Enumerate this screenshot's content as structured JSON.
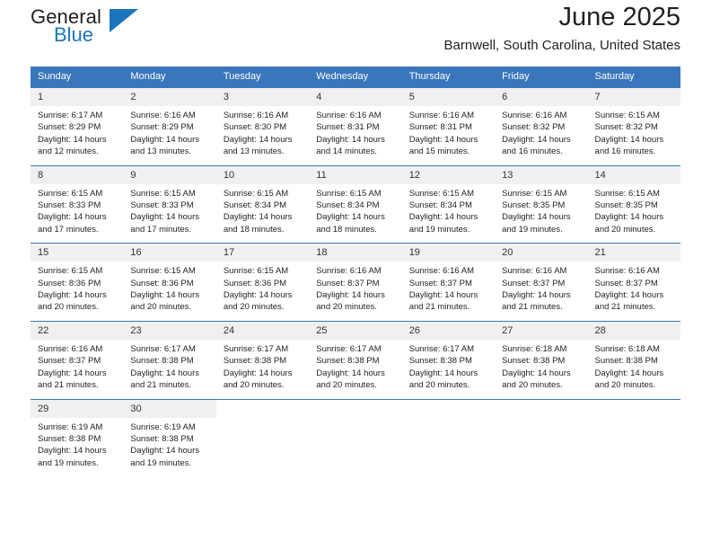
{
  "brand": {
    "name_top": "General",
    "name_bottom": "Blue",
    "triangle_icon": "brand-triangle-icon",
    "colors": {
      "black": "#231f20",
      "blue": "#1b75bb"
    }
  },
  "header": {
    "title": "June 2025",
    "location": "Barnwell, South Carolina, United States"
  },
  "calendar": {
    "header_background": "#3a76bb",
    "daynum_background": "#f0f0f0",
    "weekdays": [
      "Sunday",
      "Monday",
      "Tuesday",
      "Wednesday",
      "Thursday",
      "Friday",
      "Saturday"
    ],
    "weeks": [
      [
        {
          "day": "1",
          "sunrise": "Sunrise: 6:17 AM",
          "sunset": "Sunset: 8:29 PM",
          "daylight_1": "Daylight: 14 hours",
          "daylight_2": "and 12 minutes."
        },
        {
          "day": "2",
          "sunrise": "Sunrise: 6:16 AM",
          "sunset": "Sunset: 8:29 PM",
          "daylight_1": "Daylight: 14 hours",
          "daylight_2": "and 13 minutes."
        },
        {
          "day": "3",
          "sunrise": "Sunrise: 6:16 AM",
          "sunset": "Sunset: 8:30 PM",
          "daylight_1": "Daylight: 14 hours",
          "daylight_2": "and 13 minutes."
        },
        {
          "day": "4",
          "sunrise": "Sunrise: 6:16 AM",
          "sunset": "Sunset: 8:31 PM",
          "daylight_1": "Daylight: 14 hours",
          "daylight_2": "and 14 minutes."
        },
        {
          "day": "5",
          "sunrise": "Sunrise: 6:16 AM",
          "sunset": "Sunset: 8:31 PM",
          "daylight_1": "Daylight: 14 hours",
          "daylight_2": "and 15 minutes."
        },
        {
          "day": "6",
          "sunrise": "Sunrise: 6:16 AM",
          "sunset": "Sunset: 8:32 PM",
          "daylight_1": "Daylight: 14 hours",
          "daylight_2": "and 16 minutes."
        },
        {
          "day": "7",
          "sunrise": "Sunrise: 6:15 AM",
          "sunset": "Sunset: 8:32 PM",
          "daylight_1": "Daylight: 14 hours",
          "daylight_2": "and 16 minutes."
        }
      ],
      [
        {
          "day": "8",
          "sunrise": "Sunrise: 6:15 AM",
          "sunset": "Sunset: 8:33 PM",
          "daylight_1": "Daylight: 14 hours",
          "daylight_2": "and 17 minutes."
        },
        {
          "day": "9",
          "sunrise": "Sunrise: 6:15 AM",
          "sunset": "Sunset: 8:33 PM",
          "daylight_1": "Daylight: 14 hours",
          "daylight_2": "and 17 minutes."
        },
        {
          "day": "10",
          "sunrise": "Sunrise: 6:15 AM",
          "sunset": "Sunset: 8:34 PM",
          "daylight_1": "Daylight: 14 hours",
          "daylight_2": "and 18 minutes."
        },
        {
          "day": "11",
          "sunrise": "Sunrise: 6:15 AM",
          "sunset": "Sunset: 8:34 PM",
          "daylight_1": "Daylight: 14 hours",
          "daylight_2": "and 18 minutes."
        },
        {
          "day": "12",
          "sunrise": "Sunrise: 6:15 AM",
          "sunset": "Sunset: 8:34 PM",
          "daylight_1": "Daylight: 14 hours",
          "daylight_2": "and 19 minutes."
        },
        {
          "day": "13",
          "sunrise": "Sunrise: 6:15 AM",
          "sunset": "Sunset: 8:35 PM",
          "daylight_1": "Daylight: 14 hours",
          "daylight_2": "and 19 minutes."
        },
        {
          "day": "14",
          "sunrise": "Sunrise: 6:15 AM",
          "sunset": "Sunset: 8:35 PM",
          "daylight_1": "Daylight: 14 hours",
          "daylight_2": "and 20 minutes."
        }
      ],
      [
        {
          "day": "15",
          "sunrise": "Sunrise: 6:15 AM",
          "sunset": "Sunset: 8:36 PM",
          "daylight_1": "Daylight: 14 hours",
          "daylight_2": "and 20 minutes."
        },
        {
          "day": "16",
          "sunrise": "Sunrise: 6:15 AM",
          "sunset": "Sunset: 8:36 PM",
          "daylight_1": "Daylight: 14 hours",
          "daylight_2": "and 20 minutes."
        },
        {
          "day": "17",
          "sunrise": "Sunrise: 6:15 AM",
          "sunset": "Sunset: 8:36 PM",
          "daylight_1": "Daylight: 14 hours",
          "daylight_2": "and 20 minutes."
        },
        {
          "day": "18",
          "sunrise": "Sunrise: 6:16 AM",
          "sunset": "Sunset: 8:37 PM",
          "daylight_1": "Daylight: 14 hours",
          "daylight_2": "and 20 minutes."
        },
        {
          "day": "19",
          "sunrise": "Sunrise: 6:16 AM",
          "sunset": "Sunset: 8:37 PM",
          "daylight_1": "Daylight: 14 hours",
          "daylight_2": "and 21 minutes."
        },
        {
          "day": "20",
          "sunrise": "Sunrise: 6:16 AM",
          "sunset": "Sunset: 8:37 PM",
          "daylight_1": "Daylight: 14 hours",
          "daylight_2": "and 21 minutes."
        },
        {
          "day": "21",
          "sunrise": "Sunrise: 6:16 AM",
          "sunset": "Sunset: 8:37 PM",
          "daylight_1": "Daylight: 14 hours",
          "daylight_2": "and 21 minutes."
        }
      ],
      [
        {
          "day": "22",
          "sunrise": "Sunrise: 6:16 AM",
          "sunset": "Sunset: 8:37 PM",
          "daylight_1": "Daylight: 14 hours",
          "daylight_2": "and 21 minutes."
        },
        {
          "day": "23",
          "sunrise": "Sunrise: 6:17 AM",
          "sunset": "Sunset: 8:38 PM",
          "daylight_1": "Daylight: 14 hours",
          "daylight_2": "and 21 minutes."
        },
        {
          "day": "24",
          "sunrise": "Sunrise: 6:17 AM",
          "sunset": "Sunset: 8:38 PM",
          "daylight_1": "Daylight: 14 hours",
          "daylight_2": "and 20 minutes."
        },
        {
          "day": "25",
          "sunrise": "Sunrise: 6:17 AM",
          "sunset": "Sunset: 8:38 PM",
          "daylight_1": "Daylight: 14 hours",
          "daylight_2": "and 20 minutes."
        },
        {
          "day": "26",
          "sunrise": "Sunrise: 6:17 AM",
          "sunset": "Sunset: 8:38 PM",
          "daylight_1": "Daylight: 14 hours",
          "daylight_2": "and 20 minutes."
        },
        {
          "day": "27",
          "sunrise": "Sunrise: 6:18 AM",
          "sunset": "Sunset: 8:38 PM",
          "daylight_1": "Daylight: 14 hours",
          "daylight_2": "and 20 minutes."
        },
        {
          "day": "28",
          "sunrise": "Sunrise: 6:18 AM",
          "sunset": "Sunset: 8:38 PM",
          "daylight_1": "Daylight: 14 hours",
          "daylight_2": "and 20 minutes."
        }
      ],
      [
        {
          "day": "29",
          "sunrise": "Sunrise: 6:19 AM",
          "sunset": "Sunset: 8:38 PM",
          "daylight_1": "Daylight: 14 hours",
          "daylight_2": "and 19 minutes."
        },
        {
          "day": "30",
          "sunrise": "Sunrise: 6:19 AM",
          "sunset": "Sunset: 8:38 PM",
          "daylight_1": "Daylight: 14 hours",
          "daylight_2": "and 19 minutes."
        },
        {
          "day": "",
          "sunrise": "",
          "sunset": "",
          "daylight_1": "",
          "daylight_2": ""
        },
        {
          "day": "",
          "sunrise": "",
          "sunset": "",
          "daylight_1": "",
          "daylight_2": ""
        },
        {
          "day": "",
          "sunrise": "",
          "sunset": "",
          "daylight_1": "",
          "daylight_2": ""
        },
        {
          "day": "",
          "sunrise": "",
          "sunset": "",
          "daylight_1": "",
          "daylight_2": ""
        },
        {
          "day": "",
          "sunrise": "",
          "sunset": "",
          "daylight_1": "",
          "daylight_2": ""
        }
      ]
    ]
  }
}
